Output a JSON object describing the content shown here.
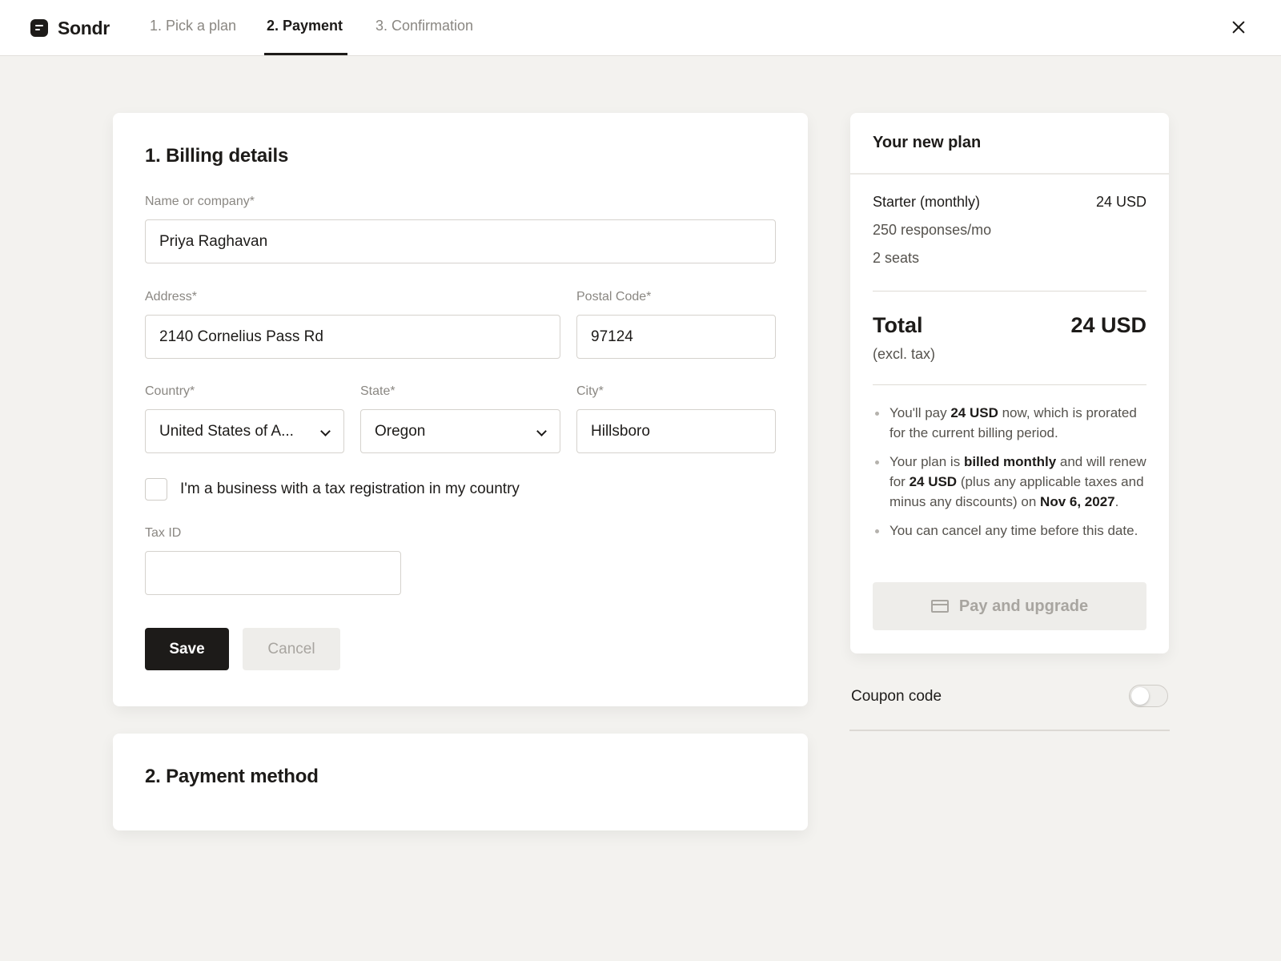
{
  "app": {
    "name": "Sondr",
    "close_icon": "close-icon",
    "logo_icon": "sondr-logo-icon"
  },
  "steps": [
    {
      "label": "1. Pick a plan",
      "active": false
    },
    {
      "label": "2. Payment",
      "active": true
    },
    {
      "label": "3. Confirmation",
      "active": false
    }
  ],
  "billing": {
    "title": "1. Billing details",
    "required_marker": "*",
    "name_label": "Name or company",
    "name_value": "Priya Raghavan",
    "address_label": "Address",
    "address_value": "2140 Cornelius Pass Rd",
    "postal_label": "Postal Code",
    "postal_value": "97124",
    "country_label": "Country",
    "country_value": "United States of A...",
    "state_label": "State",
    "state_value": "Oregon",
    "city_label": "City",
    "city_value": "Hillsboro",
    "business_checkbox_label": "I'm a business with a tax registration in my country",
    "business_checked": false,
    "tax_label": "Tax ID",
    "tax_value": "",
    "save_label": "Save",
    "cancel_label": "Cancel"
  },
  "payment_method": {
    "title": "2. Payment method"
  },
  "plan": {
    "title": "Your new plan",
    "name": "Starter (monthly)",
    "price": "24 USD",
    "responses": "250 responses/mo",
    "seats": "2 seats",
    "total_label": "Total",
    "total_value": "24 USD",
    "tax_note": "(excl. tax)",
    "bullet1_a": "You'll pay ",
    "bullet1_b": "24 USD",
    "bullet1_c": " now, which is prorated for the current billing period.",
    "bullet2_a": "Your plan is ",
    "bullet2_b": "billed monthly",
    "bullet2_c": " and will renew for ",
    "bullet2_d": "24 USD",
    "bullet2_e": " (plus any applicable taxes and minus any discounts) on ",
    "bullet2_f": "Nov 6, 2027",
    "bullet2_g": ".",
    "bullet3": "You can cancel any time before this date.",
    "pay_button_label": "Pay and upgrade",
    "pay_button_icon": "credit-card-icon"
  },
  "coupon": {
    "label": "Coupon code",
    "enabled": false
  },
  "colors": {
    "accent": "#1d1b19",
    "background": "#f3f2ef",
    "card": "#ffffff",
    "muted": "#8a8782"
  }
}
